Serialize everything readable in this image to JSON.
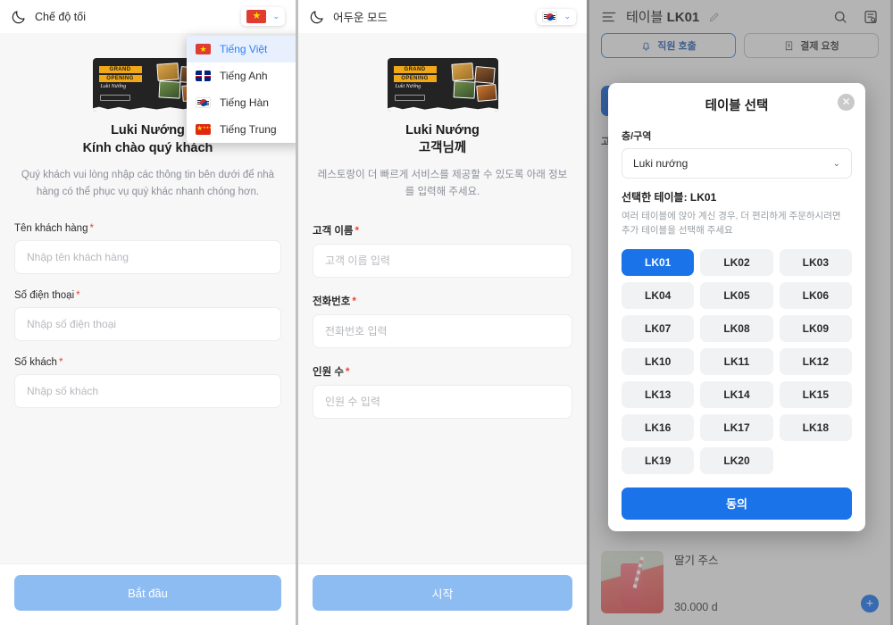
{
  "panels": {
    "vi": {
      "topbar": {
        "dark_mode_label": "Chế độ tối",
        "moon_icon": "moon-icon",
        "flag": "vn",
        "chevron": "⌄"
      },
      "hero": {
        "banner_line1": "GRAND",
        "banner_line2": "OPENING",
        "banner_script": "Luki Nướng",
        "title_line1": "Luki Nướng",
        "title_line2": "Kính chào quý khách",
        "subtitle": "Quý khách vui lòng nhập các thông tin bên dưới để nhà hàng có thể phục vụ quý khác nhanh chóng hơn."
      },
      "fields": [
        {
          "label": "Tên khách hàng",
          "required": "*",
          "placeholder": "Nhập tên khách hàng",
          "value": ""
        },
        {
          "label": "Số điện thoại",
          "required": "*",
          "placeholder": "Nhập số điện thoại",
          "value": ""
        },
        {
          "label": "Số khách",
          "required": "*",
          "placeholder": "Nhập số khách",
          "value": ""
        }
      ],
      "submit_label": "Bắt đầu"
    },
    "ko": {
      "topbar": {
        "dark_mode_label": "어두운 모드",
        "moon_icon": "moon-icon",
        "flag": "kr",
        "chevron": "⌄"
      },
      "hero": {
        "banner_line1": "GRAND",
        "banner_line2": "OPENING",
        "banner_script": "Luki Nướng",
        "title_line1": "Luki Nướng",
        "title_line2": "고객님께",
        "subtitle": "레스토랑이 더 빠르게 서비스를 제공할 수 있도록 아래 정보를 입력해 주세요."
      },
      "fields": [
        {
          "label": "고객 이름",
          "required": "*",
          "placeholder": "고객 이름 입력",
          "value": ""
        },
        {
          "label": "전화번호",
          "required": "*",
          "placeholder": "전화번호 입력",
          "value": ""
        },
        {
          "label": "인원 수",
          "required": "*",
          "placeholder": "인원 수 입력",
          "value": ""
        }
      ],
      "submit_label": "시작"
    }
  },
  "language_menu": {
    "open": true,
    "items": [
      {
        "label": "Tiếng Việt",
        "flag": "vn",
        "active": true
      },
      {
        "label": "Tiếng Anh",
        "flag": "uk",
        "active": false
      },
      {
        "label": "Tiếng Hàn",
        "flag": "kr",
        "active": false
      },
      {
        "label": "Tiếng Trung",
        "flag": "cn",
        "active": false
      }
    ]
  },
  "order_panel": {
    "menu_icon": "hamburger-icon",
    "title_prefix": "테이블 ",
    "title_value": "LK01",
    "edit_icon": "pencil-icon",
    "search_icon": "search-icon",
    "receipt_icon": "order-lookup-icon",
    "actions": [
      {
        "label": "직원 호출",
        "icon": "bell-icon"
      },
      {
        "label": "결제 요청",
        "icon": "receipt-icon"
      }
    ],
    "behind_text": "고",
    "product": {
      "name": "딸기 주스",
      "price": "30.000 d",
      "add_icon": "plus-icon",
      "image": "strawberry-juice-photo"
    }
  },
  "table_modal": {
    "title": "테이블 선택",
    "close_icon": "close-icon",
    "zone_label": "층/구역",
    "zone_value": "Luki nướng",
    "zone_chevron": "⌄",
    "selected_label": "선택한 테이블: LK01",
    "hint": "여러 테이블에 앉아 계신 경우, 더 편리하게 주문하시려면 추가 테이블을 선택해 주세요",
    "tables": [
      {
        "label": "LK01",
        "selected": true
      },
      {
        "label": "LK02",
        "selected": false
      },
      {
        "label": "LK03",
        "selected": false
      },
      {
        "label": "LK04",
        "selected": false
      },
      {
        "label": "LK05",
        "selected": false
      },
      {
        "label": "LK06",
        "selected": false
      },
      {
        "label": "LK07",
        "selected": false
      },
      {
        "label": "LK08",
        "selected": false
      },
      {
        "label": "LK09",
        "selected": false
      },
      {
        "label": "LK10",
        "selected": false
      },
      {
        "label": "LK11",
        "selected": false
      },
      {
        "label": "LK12",
        "selected": false
      },
      {
        "label": "LK13",
        "selected": false
      },
      {
        "label": "LK14",
        "selected": false
      },
      {
        "label": "LK15",
        "selected": false
      },
      {
        "label": "LK16",
        "selected": false
      },
      {
        "label": "LK17",
        "selected": false
      },
      {
        "label": "LK18",
        "selected": false
      },
      {
        "label": "LK19",
        "selected": false
      },
      {
        "label": "LK20",
        "selected": false
      }
    ],
    "confirm_label": "동의"
  },
  "colors": {
    "accent": "#1a73e8",
    "accent_muted": "#8dbcf2",
    "required": "#f0402f",
    "panel_bg": "#f7f7f8"
  }
}
